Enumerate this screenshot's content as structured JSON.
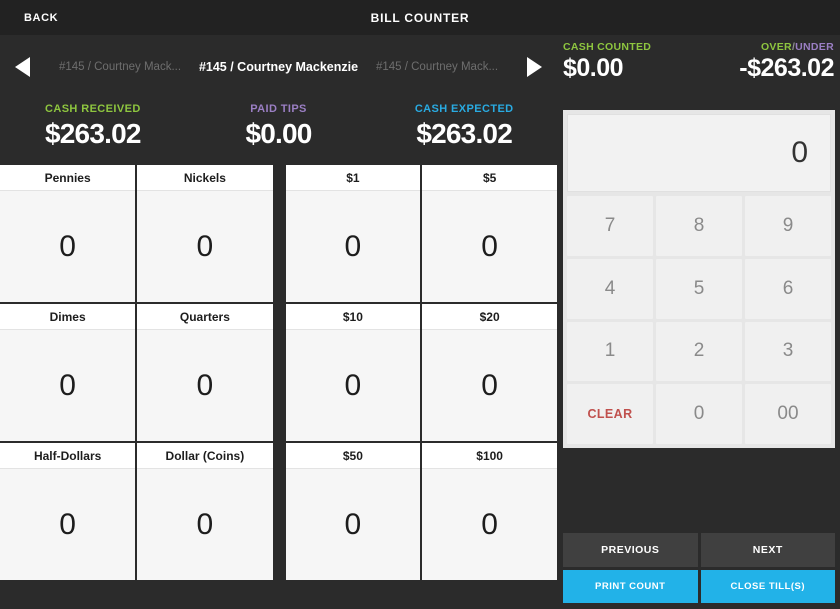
{
  "header": {
    "back_label": "BACK",
    "title": "BILL COUNTER"
  },
  "navigation": {
    "prev_icon": "triangle-left-icon",
    "next_icon": "triangle-right-icon",
    "prev_label": "#145 / Courtney Mack...",
    "current_label": "#145 / Courtney Mackenzie",
    "next_label": "#145 / Courtney Mack..."
  },
  "counted": {
    "cash_counted_label": "CASH COUNTED",
    "cash_counted_value": "$0.00",
    "over_label": "OVER",
    "separator": "/",
    "under_label": "UNDER",
    "over_under_value": "-$263.02"
  },
  "summary": [
    {
      "label": "CASH RECEIVED",
      "value": "$263.02",
      "color_class": "green",
      "color": "#8ec63f"
    },
    {
      "label": "PAID TIPS",
      "value": "$0.00",
      "color_class": "purple",
      "color": "#9b7fc4"
    },
    {
      "label": "CASH EXPECTED",
      "value": "$263.02",
      "color_class": "blue",
      "color": "#29abe2"
    }
  ],
  "coins": [
    [
      {
        "label": "Pennies",
        "value": "0"
      },
      {
        "label": "Nickels",
        "value": "0"
      }
    ],
    [
      {
        "label": "Dimes",
        "value": "0"
      },
      {
        "label": "Quarters",
        "value": "0"
      }
    ],
    [
      {
        "label": "Half-Dollars",
        "value": "0"
      },
      {
        "label": "Dollar (Coins)",
        "value": "0"
      }
    ]
  ],
  "bills": [
    [
      {
        "label": "$1",
        "value": "0"
      },
      {
        "label": "$5",
        "value": "0"
      }
    ],
    [
      {
        "label": "$10",
        "value": "0"
      },
      {
        "label": "$20",
        "value": "0"
      }
    ],
    [
      {
        "label": "$50",
        "value": "0"
      },
      {
        "label": "$100",
        "value": "0"
      }
    ]
  ],
  "keypad": {
    "display_value": "0",
    "keys": [
      "7",
      "8",
      "9",
      "4",
      "5",
      "6",
      "1",
      "2",
      "3",
      "CLEAR",
      "0",
      "00"
    ]
  },
  "actions": {
    "previous": "PREVIOUS",
    "next": "NEXT",
    "print_count": "PRINT COUNT",
    "close_tills": "CLOSE TILL(S)"
  },
  "colors": {
    "background": "#2b2b2b",
    "titlebar": "#222222",
    "accent_cyan": "#22b2e8",
    "accent_green": "#8ec63f",
    "accent_purple": "#9b7fc4",
    "accent_blue": "#29abe2",
    "clear_red": "#c0504d"
  }
}
